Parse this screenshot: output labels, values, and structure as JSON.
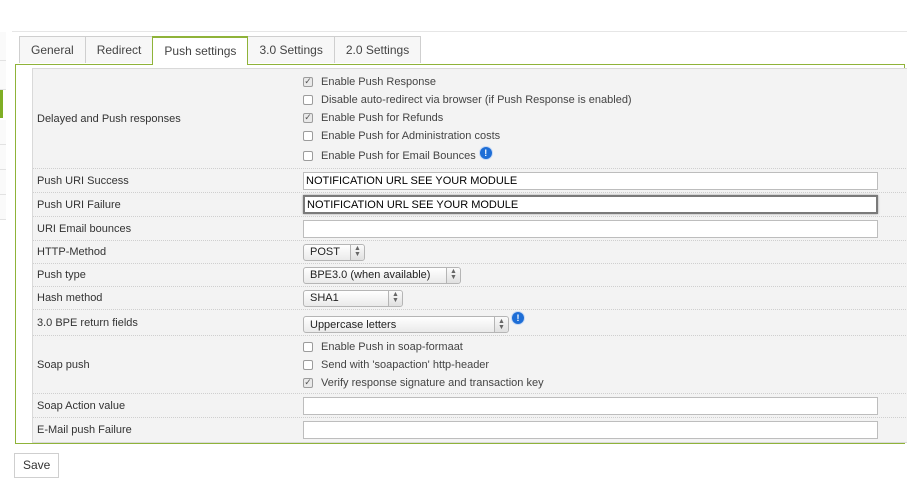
{
  "tabs": [
    {
      "label": "General"
    },
    {
      "label": "Redirect"
    },
    {
      "label": "Push settings",
      "active": true
    },
    {
      "label": "3.0 Settings"
    },
    {
      "label": "2.0 Settings"
    }
  ],
  "rows": {
    "delayed": {
      "label": "Delayed and Push responses",
      "options": [
        {
          "label": "Enable Push Response",
          "checked": true
        },
        {
          "label": "Disable auto-redirect via browser (if Push Response is enabled)",
          "checked": false
        },
        {
          "label": "Enable Push for Refunds",
          "checked": true
        },
        {
          "label": "Enable Push for Administration costs",
          "checked": false
        },
        {
          "label": "Enable Push for Email Bounces",
          "checked": false
        }
      ]
    },
    "push_uri_success": {
      "label": "Push URI Success",
      "value": "NOTIFICATION URL SEE YOUR MODULE"
    },
    "push_uri_failure": {
      "label": "Push URI Failure",
      "value": "NOTIFICATION URL SEE YOUR MODULE"
    },
    "uri_email_bounces": {
      "label": "URI Email bounces",
      "value": ""
    },
    "http_method": {
      "label": "HTTP-Method",
      "selected": "POST"
    },
    "push_type": {
      "label": "Push type",
      "selected": "BPE3.0 (when available)"
    },
    "hash_method": {
      "label": "Hash method",
      "selected": "SHA1"
    },
    "bpe_return_fields": {
      "label": "3.0 BPE return fields",
      "selected": "Uppercase letters"
    },
    "soap_push": {
      "label": "Soap push",
      "options": [
        {
          "label": "Enable Push in soap-formaat",
          "checked": false
        },
        {
          "label": "Send with 'soapaction' http-header",
          "checked": false
        },
        {
          "label": "Verify response signature and transaction key",
          "checked": true
        }
      ]
    },
    "soap_action_value": {
      "label": "Soap Action value",
      "value": ""
    },
    "email_push_failure": {
      "label": "E-Mail push Failure",
      "value": ""
    }
  },
  "save_label": "Save",
  "icons": {
    "checkmark": "✓",
    "info": "!",
    "select_arrows": "updown-chevrons"
  },
  "colors": {
    "accent": "#8fb339",
    "info": "#1e6ed6"
  }
}
